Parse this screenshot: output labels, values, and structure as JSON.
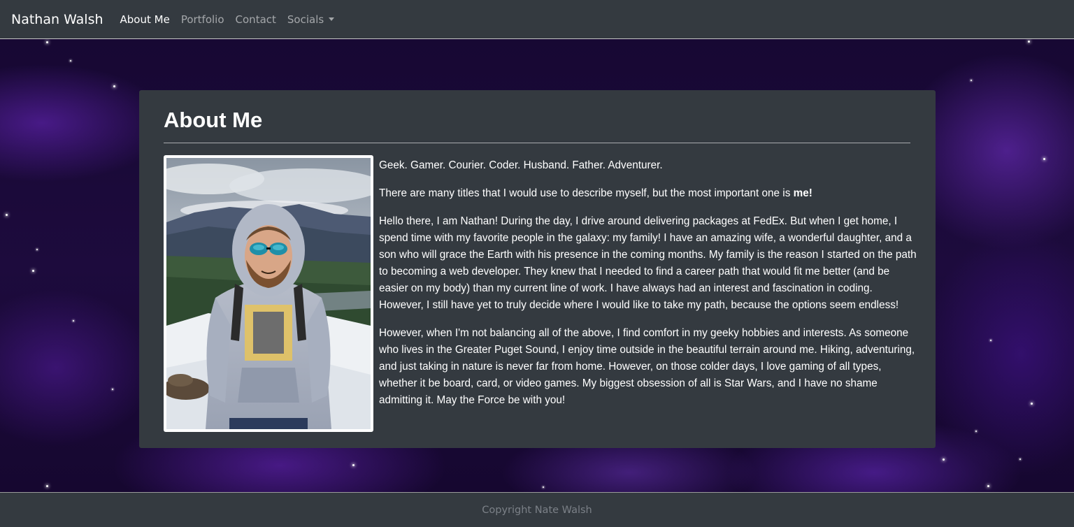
{
  "navbar": {
    "brand": "Nathan Walsh",
    "links": [
      {
        "label": "About Me",
        "active": true
      },
      {
        "label": "Portfolio",
        "active": false
      },
      {
        "label": "Contact",
        "active": false
      },
      {
        "label": "Socials",
        "active": false,
        "dropdown": true
      }
    ]
  },
  "about": {
    "title": "About Me",
    "photo_alt": "Photo of Nathan Walsh standing on a snowy mountain wearing sunglasses and a grey hoodie",
    "tagline": "Geek. Gamer. Courier. Coder. Husband. Father. Adventurer.",
    "titles_intro": "There are many titles that I would use to describe myself, but the most important one is ",
    "titles_emphasis": "me!",
    "paragraph_1": "Hello there, I am Nathan! During the day, I drive around delivering packages at FedEx. But when I get home, I spend time with my favorite people in the galaxy: my family! I have an amazing wife, a wonderful daughter, and a son who will grace the Earth with his presence in the coming months. My family is the reason I started on the path to becoming a web developer. They knew that I needed to find a career path that would fit me better (and be easier on my body) than my current line of work. I have always had an interest and fascination in coding. However, I still have yet to truly decide where I would like to take my path, because the options seem endless!",
    "paragraph_2": "However, when I'm not balancing all of the above, I find comfort in my geeky hobbies and interests. As someone who lives in the Greater Puget Sound, I enjoy time outside in the beautiful terrain around me. Hiking, adventuring, and just taking in nature is never far from home. However, on those colder days, I love gaming of all types, whether it be board, card, or video games. My biggest obsession of all is Star Wars, and I have no shame admitting it. May the Force be with you!"
  },
  "footer": {
    "text": "Copyright Nate Walsh"
  },
  "colors": {
    "navbar_bg": "#343a40",
    "card_bg": "#343a40",
    "text": "#ffffff",
    "nav_muted": "rgba(255,255,255,0.55)",
    "footer_text": "#7b8087",
    "space_accent": "#6a2ad0"
  },
  "icons": {
    "socials_dropdown": "caret-down-icon"
  }
}
